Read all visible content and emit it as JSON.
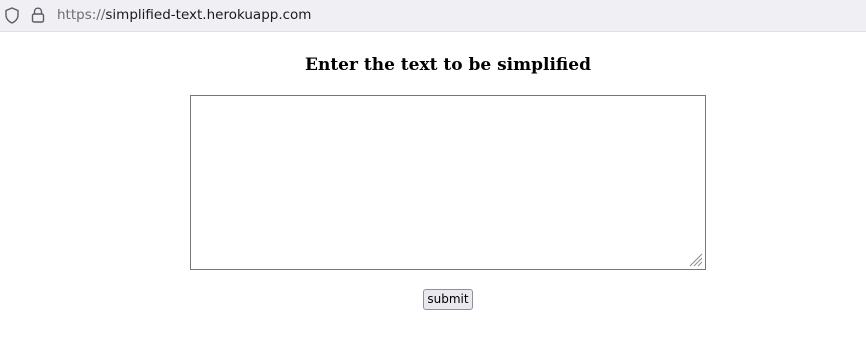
{
  "browser": {
    "url_scheme": "https://",
    "url_host": "simplified-text.herokuapp.com",
    "security_icon": "shield-icon",
    "lock_icon": "lock-icon"
  },
  "page": {
    "heading": "Enter the text to be simplified",
    "textarea_value": "",
    "submit_label": "submit"
  }
}
